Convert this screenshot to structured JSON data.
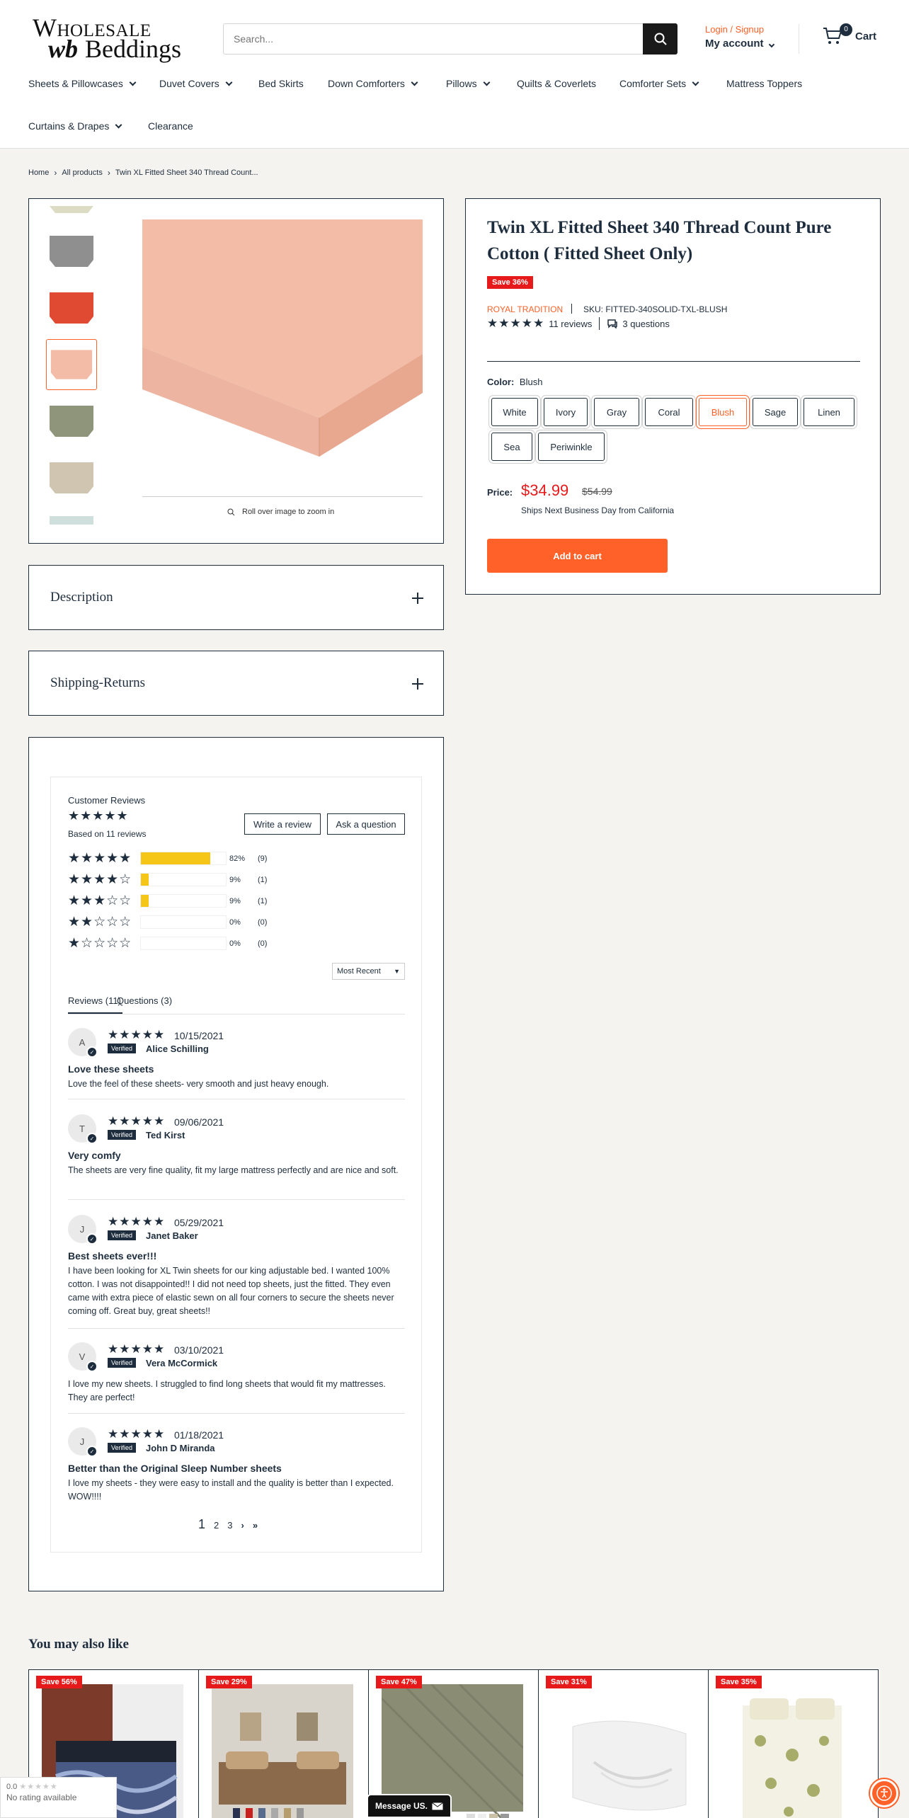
{
  "header": {
    "logo_line1": "Wholesale",
    "logo_wb": "wb",
    "logo_line2": "Beddings",
    "search_placeholder": "Search...",
    "login_label": "Login / Signup",
    "account_label": "My account",
    "cart_count": "0",
    "cart_label": "Cart"
  },
  "nav": [
    {
      "label": "Sheets & Pillowcases",
      "has_dropdown": true
    },
    {
      "label": "Duvet Covers",
      "has_dropdown": true
    },
    {
      "label": "Bed Skirts",
      "has_dropdown": false
    },
    {
      "label": "Down Comforters",
      "has_dropdown": true
    },
    {
      "label": "Pillows",
      "has_dropdown": true
    },
    {
      "label": "Quilts & Coverlets",
      "has_dropdown": false
    },
    {
      "label": "Comforter Sets",
      "has_dropdown": true
    },
    {
      "label": "Mattress Toppers",
      "has_dropdown": false
    },
    {
      "label": "Curtains & Drapes",
      "has_dropdown": true
    },
    {
      "label": "Clearance",
      "has_dropdown": false
    }
  ],
  "breadcrumb": [
    "Home",
    "All products",
    "Twin XL Fitted Sheet 340 Thread Count..."
  ],
  "gallery": {
    "zoom_hint": "Roll over image to zoom in",
    "main_color": "#f2bca6",
    "thumb_colors": [
      "#dcdcc4",
      "#8f8f8f",
      "#e04a32",
      "#f2bca6",
      "#8f957a",
      "#cfc5b0",
      "#cfdfdc"
    ]
  },
  "accordions": {
    "description": "Description",
    "shipping": "Shipping-Returns"
  },
  "product": {
    "title": "Twin XL Fitted Sheet 340 Thread Count Pure Cotton ( Fitted Sheet Only)",
    "save_badge": "Save 36%",
    "vendor": "ROYAL TRADITION",
    "sku": "SKU: FITTED-340SOLID-TXL-BLUSH",
    "stars": "★★★★★",
    "reviews_link": "11 reviews",
    "questions_link": "3 questions",
    "color_label": "Color:",
    "color_value": "Blush",
    "colors": [
      "White",
      "Ivory",
      "Gray",
      "Coral",
      "Blush",
      "Sage",
      "Linen",
      "Sea",
      "Periwinkle"
    ],
    "selected_color": "Blush",
    "price_label": "Price:",
    "price": "$34.99",
    "compare_price": "$54.99",
    "shipping_note": "Ships Next Business Day from California",
    "add_to_cart": "Add to cart"
  },
  "reviews": {
    "heading": "Customer Reviews",
    "average_rating": 4.5,
    "summary_stars": "★★★★★",
    "based_on": "Based on 11 reviews",
    "write_review": "Write a review",
    "ask_question": "Ask a question",
    "distribution": [
      {
        "stars": "★★★★★",
        "fraction": 0.82,
        "percent": "82%",
        "count": "(9)"
      },
      {
        "stars": "★★★★☆",
        "fraction": 0.09,
        "percent": "9%",
        "count": "(1)"
      },
      {
        "stars": "★★★☆☆",
        "fraction": 0.09,
        "percent": "9%",
        "count": "(1)"
      },
      {
        "stars": "★★☆☆☆",
        "fraction": 0,
        "percent": "0%",
        "count": "(0)"
      },
      {
        "stars": "★☆☆☆☆",
        "fraction": 0,
        "percent": "0%",
        "count": "(0)"
      }
    ],
    "sort": "Most Recent",
    "tab_reviews": "Reviews (11)",
    "tab_questions": "Questions (3)",
    "verified": "Verified",
    "items": [
      {
        "initial": "A",
        "stars": "★★★★★",
        "date": "10/15/2021",
        "name": "Alice Schilling",
        "title": "Love these sheets",
        "body": "Love the feel of these sheets- very smooth and just heavy enough."
      },
      {
        "initial": "T",
        "stars": "★★★★★",
        "date": "09/06/2021",
        "name": "Ted Kirst",
        "title": "Very comfy",
        "body": "The sheets are very fine quality, fit my large mattress perfectly and are nice and soft."
      },
      {
        "initial": "J",
        "stars": "★★★★★",
        "date": "05/29/2021",
        "name": "Janet Baker",
        "title": "Best sheets ever!!!",
        "body": "I have been looking for XL Twin sheets for our king adjustable bed. I wanted 100% cotton. I was not disappointed!! I did not need top sheets, just the fitted. They even came with extra piece of elastic sewn on all four corners to secure the sheets never coming off. Great buy, great sheets!!"
      },
      {
        "initial": "V",
        "stars": "★★★★★",
        "date": "03/10/2021",
        "name": "Vera McCormick",
        "title": "",
        "body": "I love my new sheets. I struggled to find long sheets that would fit my mattresses. They are perfect!"
      },
      {
        "initial": "J",
        "stars": "★★★★★",
        "date": "01/18/2021",
        "name": "John D Miranda",
        "title": "Better than the Original Sleep Number sheets",
        "body": "I love my sheets - they were easy to install and the quality is better than I expected. WOW!!!!"
      }
    ],
    "pages": [
      "1",
      "2",
      "3"
    ],
    "next": "›",
    "last": "»"
  },
  "also_like": {
    "heading": "You may also like",
    "badges": [
      "Save 56%",
      "Save 29%",
      "Save 47%",
      "Save 31%",
      "Save 35%"
    ]
  },
  "widgets": {
    "google_rating": "0.0",
    "google_stars": "★★★★★",
    "google_text": "No rating available",
    "message": "Message US."
  },
  "colors": {
    "accent": "#ff6128",
    "sale": "#e61a1a",
    "text": "#1e2d3d",
    "rating_bar": "#f5c518"
  }
}
